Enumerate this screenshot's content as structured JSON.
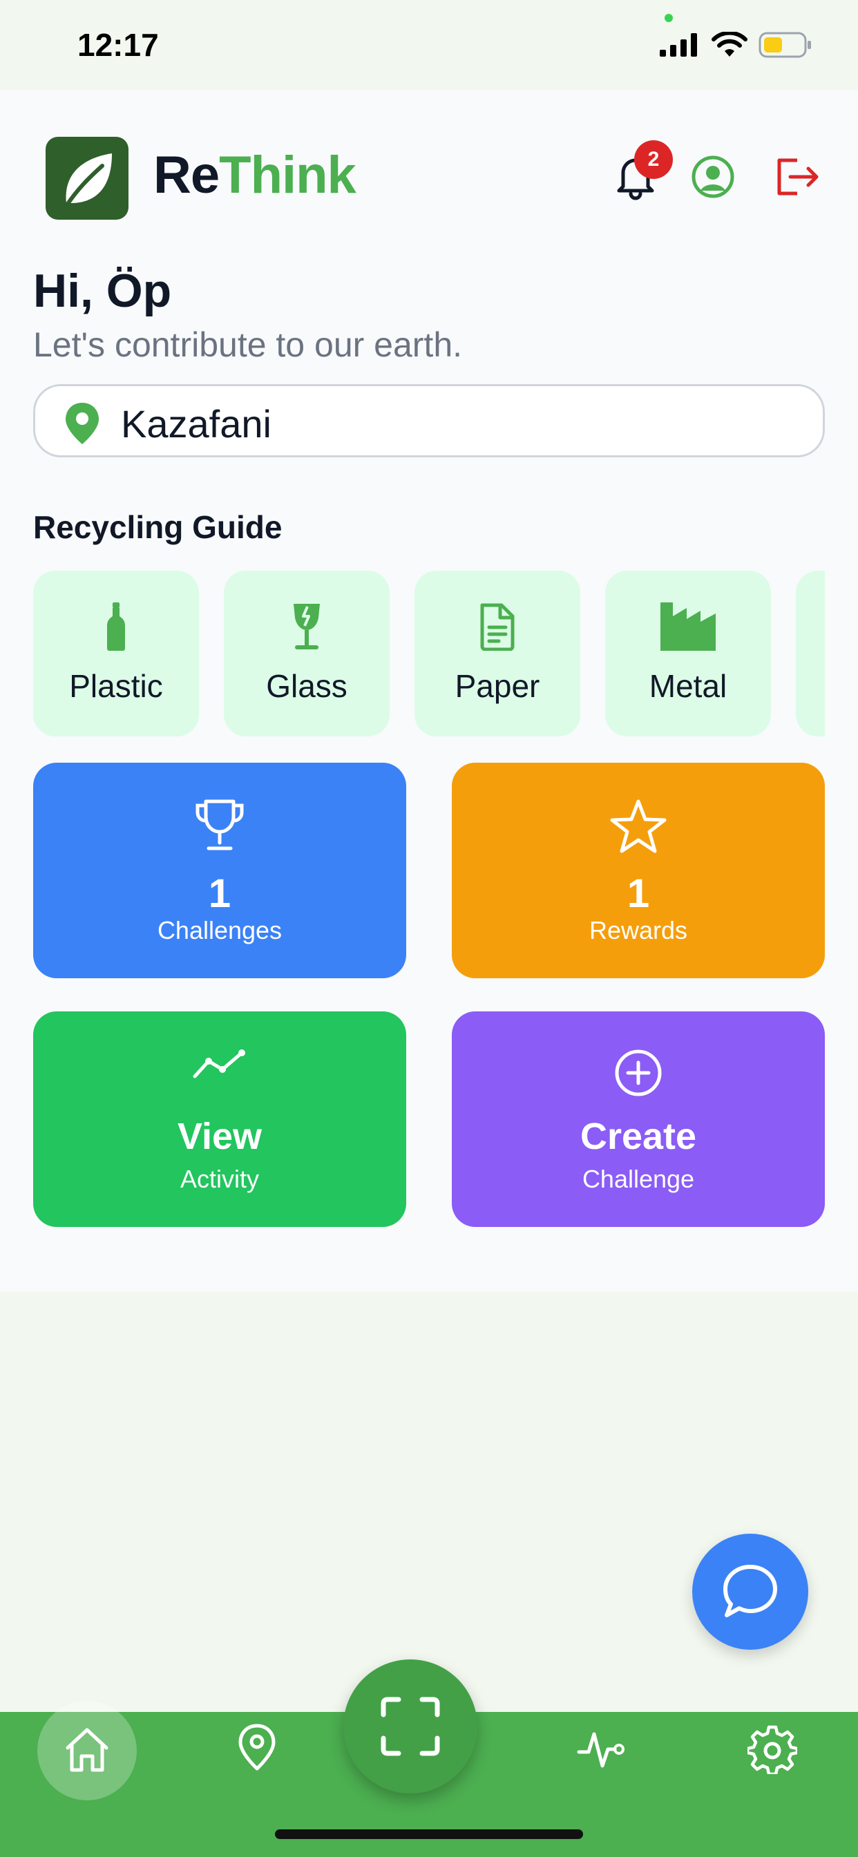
{
  "status_bar": {
    "time": "12:17"
  },
  "header": {
    "brand_part1": "Re",
    "brand_part2": "Think",
    "notification_count": "2",
    "colors": {
      "brand_green": "#4caf50",
      "logout_red": "#dc2626"
    }
  },
  "greeting": {
    "title": "Hi, Öp",
    "subtitle": "Let's contribute to our earth."
  },
  "location": {
    "value": "Kazafani"
  },
  "recycling_guide": {
    "title": "Recycling Guide",
    "items": [
      {
        "label": "Plastic",
        "icon": "bottle-icon"
      },
      {
        "label": "Glass",
        "icon": "wine-glass-icon"
      },
      {
        "label": "Paper",
        "icon": "document-icon"
      },
      {
        "label": "Metal",
        "icon": "factory-icon"
      }
    ]
  },
  "tiles": {
    "challenges": {
      "value": "1",
      "label": "Challenges",
      "color": "#3b82f6"
    },
    "rewards": {
      "value": "1",
      "label": "Rewards",
      "color": "#f59e0b"
    },
    "activity": {
      "title": "View",
      "label": "Activity",
      "color": "#22c55e"
    },
    "create": {
      "title": "Create",
      "label": "Challenge",
      "color": "#8b5cf6"
    }
  },
  "bottom_nav": {
    "items": [
      "home-icon",
      "map-pin-icon",
      "scan-icon",
      "activity-icon",
      "settings-icon"
    ],
    "color": "#4caf50"
  }
}
